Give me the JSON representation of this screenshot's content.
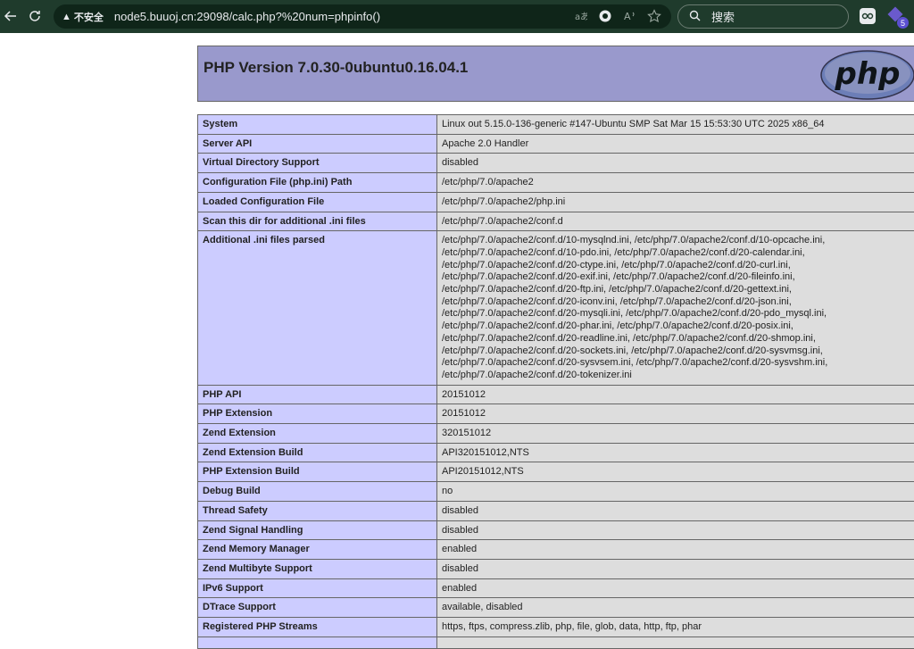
{
  "browser": {
    "security_label": "不安全",
    "url": "node5.buuoj.cn:29098/calc.php?%20num=phpinfo()",
    "search_placeholder": "搜索",
    "extension_badge": "5",
    "icons": [
      "back-arrow-icon",
      "reload-icon",
      "warning-icon",
      "translate-icon",
      "edge-copilot-icon",
      "read-aloud-icon",
      "favorite-star-icon",
      "search-icon",
      "extension-icon",
      "extension-gem-icon"
    ]
  },
  "php": {
    "title": "PHP Version 7.0.30-0ubuntu0.16.04.1",
    "logo_text": "php",
    "colors": {
      "header": "#9999cc",
      "key_cell": "#ccccff",
      "value_cell": "#dddddd"
    },
    "rows": [
      {
        "key": "System",
        "value": "Linux out 5.15.0-136-generic #147-Ubuntu SMP Sat Mar 15 15:53:30 UTC 2025 x86_64"
      },
      {
        "key": "Server API",
        "value": "Apache 2.0 Handler"
      },
      {
        "key": "Virtual Directory Support",
        "value": "disabled"
      },
      {
        "key": "Configuration File (php.ini) Path",
        "value": "/etc/php/7.0/apache2"
      },
      {
        "key": "Loaded Configuration File",
        "value": "/etc/php/7.0/apache2/php.ini"
      },
      {
        "key": "Scan this dir for additional .ini files",
        "value": "/etc/php/7.0/apache2/conf.d"
      },
      {
        "key": "Additional .ini files parsed",
        "lines": [
          "/etc/php/7.0/apache2/conf.d/10-mysqlnd.ini, /etc/php/7.0/apache2/conf.d/10-opcache.ini,",
          "/etc/php/7.0/apache2/conf.d/10-pdo.ini, /etc/php/7.0/apache2/conf.d/20-calendar.ini,",
          "/etc/php/7.0/apache2/conf.d/20-ctype.ini, /etc/php/7.0/apache2/conf.d/20-curl.ini,",
          "/etc/php/7.0/apache2/conf.d/20-exif.ini, /etc/php/7.0/apache2/conf.d/20-fileinfo.ini,",
          "/etc/php/7.0/apache2/conf.d/20-ftp.ini, /etc/php/7.0/apache2/conf.d/20-gettext.ini,",
          "/etc/php/7.0/apache2/conf.d/20-iconv.ini, /etc/php/7.0/apache2/conf.d/20-json.ini,",
          "/etc/php/7.0/apache2/conf.d/20-mysqli.ini, /etc/php/7.0/apache2/conf.d/20-pdo_mysql.ini,",
          "/etc/php/7.0/apache2/conf.d/20-phar.ini, /etc/php/7.0/apache2/conf.d/20-posix.ini,",
          "/etc/php/7.0/apache2/conf.d/20-readline.ini, /etc/php/7.0/apache2/conf.d/20-shmop.ini,",
          "/etc/php/7.0/apache2/conf.d/20-sockets.ini, /etc/php/7.0/apache2/conf.d/20-sysvmsg.ini,",
          "/etc/php/7.0/apache2/conf.d/20-sysvsem.ini, /etc/php/7.0/apache2/conf.d/20-sysvshm.ini,",
          "/etc/php/7.0/apache2/conf.d/20-tokenizer.ini"
        ]
      },
      {
        "key": "PHP API",
        "value": "20151012"
      },
      {
        "key": "PHP Extension",
        "value": "20151012"
      },
      {
        "key": "Zend Extension",
        "value": "320151012"
      },
      {
        "key": "Zend Extension Build",
        "value": "API320151012,NTS"
      },
      {
        "key": "PHP Extension Build",
        "value": "API20151012,NTS"
      },
      {
        "key": "Debug Build",
        "value": "no"
      },
      {
        "key": "Thread Safety",
        "value": "disabled"
      },
      {
        "key": "Zend Signal Handling",
        "value": "disabled"
      },
      {
        "key": "Zend Memory Manager",
        "value": "enabled"
      },
      {
        "key": "Zend Multibyte Support",
        "value": "disabled"
      },
      {
        "key": "IPv6 Support",
        "value": "enabled"
      },
      {
        "key": "DTrace Support",
        "value": "available, disabled"
      },
      {
        "key": "Registered PHP Streams",
        "value": "https, ftps, compress.zlib, php, file, glob, data, http, ftp, phar"
      },
      {
        "key": "",
        "value": ""
      }
    ]
  }
}
